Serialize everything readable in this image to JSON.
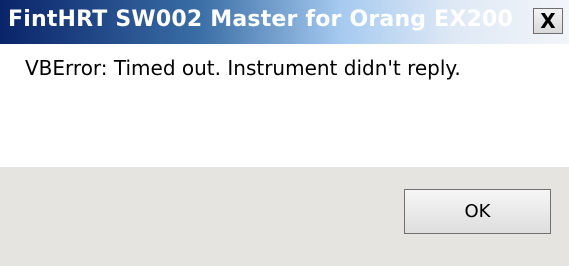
{
  "window": {
    "title": "FintHRT SW002 Master for Orang EX200",
    "close_glyph": "X"
  },
  "dialog": {
    "message": "VBError: Timed out. Instrument didn't reply.",
    "ok_label": "OK"
  },
  "icons": {
    "close": "close-icon"
  },
  "colors": {
    "titlebar_start": "#0a246a",
    "titlebar_end": "#f2f5fa",
    "footer_bg": "#e6e4e0"
  }
}
